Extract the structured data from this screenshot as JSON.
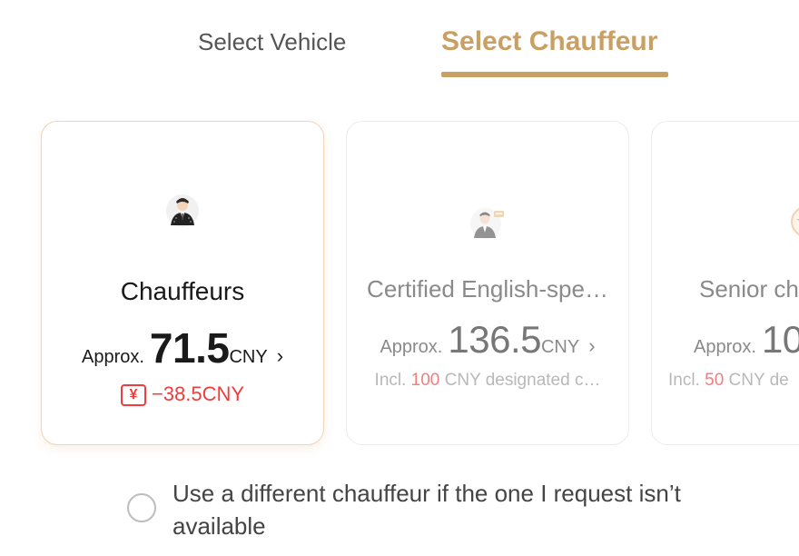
{
  "tabs": {
    "vehicle": "Select Vehicle",
    "chauffeur": "Select Chauffeur"
  },
  "colors": {
    "accent": "#c9a063",
    "discount_red": "#f03c3c"
  },
  "cards": [
    {
      "title": "Chauffeurs",
      "approx": "Approx.",
      "price": "71.5",
      "currency": "CNY",
      "chevron": "›",
      "discount_icon": "¥",
      "discount": "−38.5CNY",
      "selected": true,
      "icon": "chauffeur-avatar-icon"
    },
    {
      "title": "Certified English-spe…",
      "approx": "Approx.",
      "price": "136.5",
      "currency": "CNY",
      "chevron": "›",
      "note_prefix": "Incl. ",
      "note_amount": "100",
      "note_suffix": " CNY designated c…",
      "selected": false,
      "icon": "english-chauffeur-avatar-icon"
    },
    {
      "title": "Senior ch",
      "approx": "Approx.",
      "price": "10",
      "note_prefix": "Incl. ",
      "note_amount": "50",
      "note_suffix": " CNY de",
      "selected": false,
      "icon": "star-badge-icon"
    }
  ],
  "option": {
    "text": "Use a different chauffeur if the one I request isn’t available",
    "checked": false
  }
}
